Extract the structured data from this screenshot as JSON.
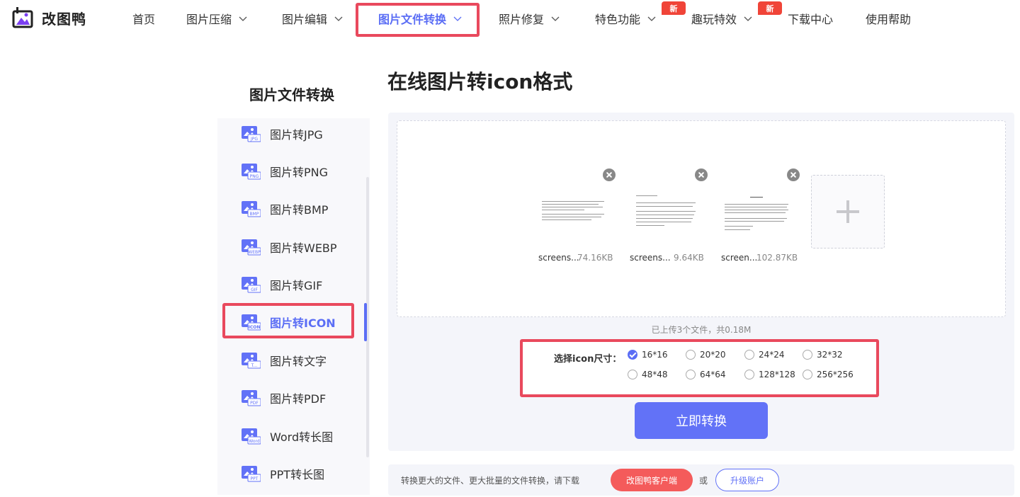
{
  "brand": {
    "name": "改图鸭"
  },
  "nav": [
    {
      "label": "首页",
      "dropdown": false
    },
    {
      "label": "图片压缩",
      "dropdown": true
    },
    {
      "label": "图片编辑",
      "dropdown": true
    },
    {
      "label": "图片文件转换",
      "dropdown": true,
      "active": true
    },
    {
      "label": "照片修复",
      "dropdown": true
    },
    {
      "label": "特色功能",
      "dropdown": true,
      "badge": "新"
    },
    {
      "label": "趣玩特效",
      "dropdown": true,
      "badge": "新"
    },
    {
      "label": "下载中心",
      "dropdown": false
    },
    {
      "label": "使用帮助",
      "dropdown": false
    }
  ],
  "sidebar": {
    "title": "图片文件转换",
    "items": [
      {
        "label": "图片转JPG",
        "icon_tag": "JPG"
      },
      {
        "label": "图片转PNG",
        "icon_tag": "PNG"
      },
      {
        "label": "图片转BMP",
        "icon_tag": "BMP"
      },
      {
        "label": "图片转WEBP",
        "icon_tag": "WEBP"
      },
      {
        "label": "图片转GIF",
        "icon_tag": "GIF"
      },
      {
        "label": "图片转ICON",
        "icon_tag": "ICON",
        "active": true
      },
      {
        "label": "图片转文字",
        "icon_tag": "T..."
      },
      {
        "label": "图片转PDF",
        "icon_tag": "PDF"
      },
      {
        "label": "Word转长图",
        "icon_tag": "Word"
      },
      {
        "label": "PPT转长图",
        "icon_tag": "PPT"
      }
    ]
  },
  "main": {
    "title": "在线图片转icon格式",
    "files": [
      {
        "name": "screens...",
        "size": "74.16KB"
      },
      {
        "name": "screens...",
        "size": "9.64KB"
      },
      {
        "name": "screen...",
        "size": "102.87KB"
      }
    ],
    "upload_info": "已上传3个文件，共0.18M",
    "size_label": "选择icon尺寸：",
    "sizes": [
      {
        "label": "16*16",
        "checked": true
      },
      {
        "label": "20*20",
        "checked": false
      },
      {
        "label": "24*24",
        "checked": false
      },
      {
        "label": "32*32",
        "checked": false
      },
      {
        "label": "48*48",
        "checked": false
      },
      {
        "label": "64*64",
        "checked": false
      },
      {
        "label": "128*128",
        "checked": false
      },
      {
        "label": "256*256",
        "checked": false
      }
    ],
    "convert_label": "立即转换"
  },
  "bottom": {
    "text": "转换更大的文件、更大批量的文件转换，请下载",
    "client_label": "改图鸭客户端",
    "or": "或",
    "upgrade_label": "升级账户"
  },
  "colors": {
    "accent": "#6272f7",
    "highlight": "#e9495d",
    "badge": "#f04438"
  }
}
